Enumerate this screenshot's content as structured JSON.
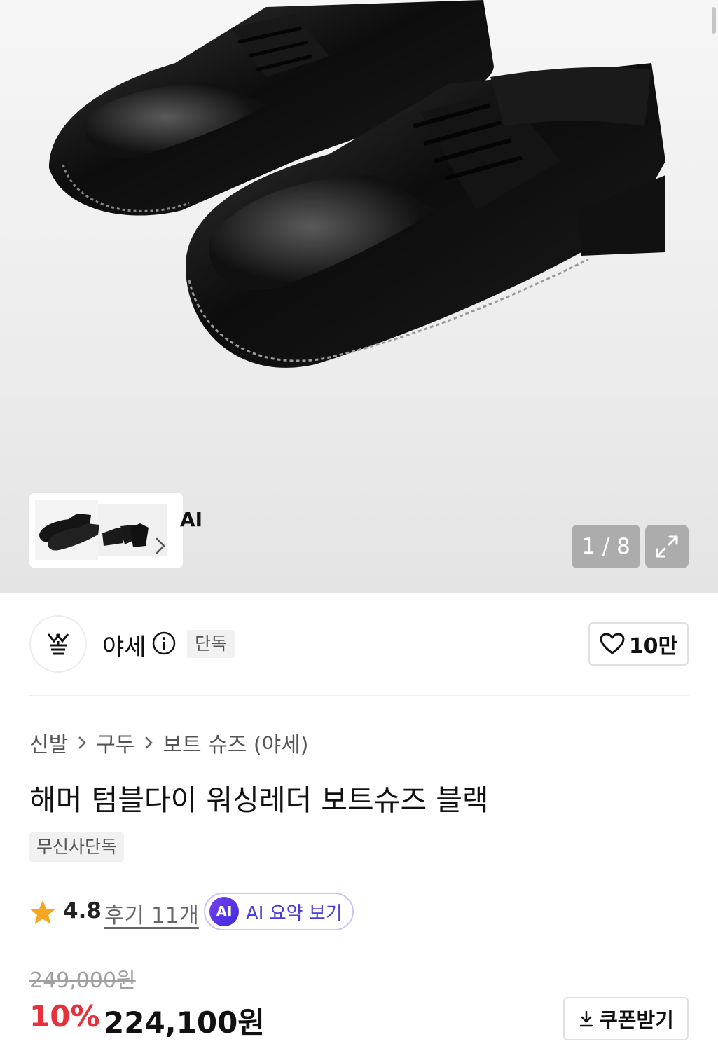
{
  "gallery": {
    "counter": "1 / 8",
    "ai_label": "AI",
    "current_index": 1,
    "total": 8
  },
  "brand": {
    "name": "야세",
    "tag": "단독",
    "likes": "10만"
  },
  "breadcrumb": [
    "신발",
    "구두",
    "보트 슈즈 (야세)"
  ],
  "product": {
    "title": "해머 텀블다이 워싱레더 보트슈즈 블랙",
    "badge": "무신사단독",
    "rating": "4.8",
    "reviews": "후기 11개",
    "ai_badge": "AI",
    "ai_summary": "AI 요약 보기",
    "original_price": "249,000원",
    "discount": "10%",
    "price": "224,100원",
    "coupon": "쿠폰받기"
  },
  "colors": {
    "discount": "#e8303a",
    "ai_accent": "#4a3ad8",
    "star": "#f5a623"
  },
  "icons": [
    "info-icon",
    "heart-icon",
    "star-icon",
    "download-icon",
    "expand-icon",
    "chevron-right-icon",
    "chevron-right-small-icon"
  ]
}
